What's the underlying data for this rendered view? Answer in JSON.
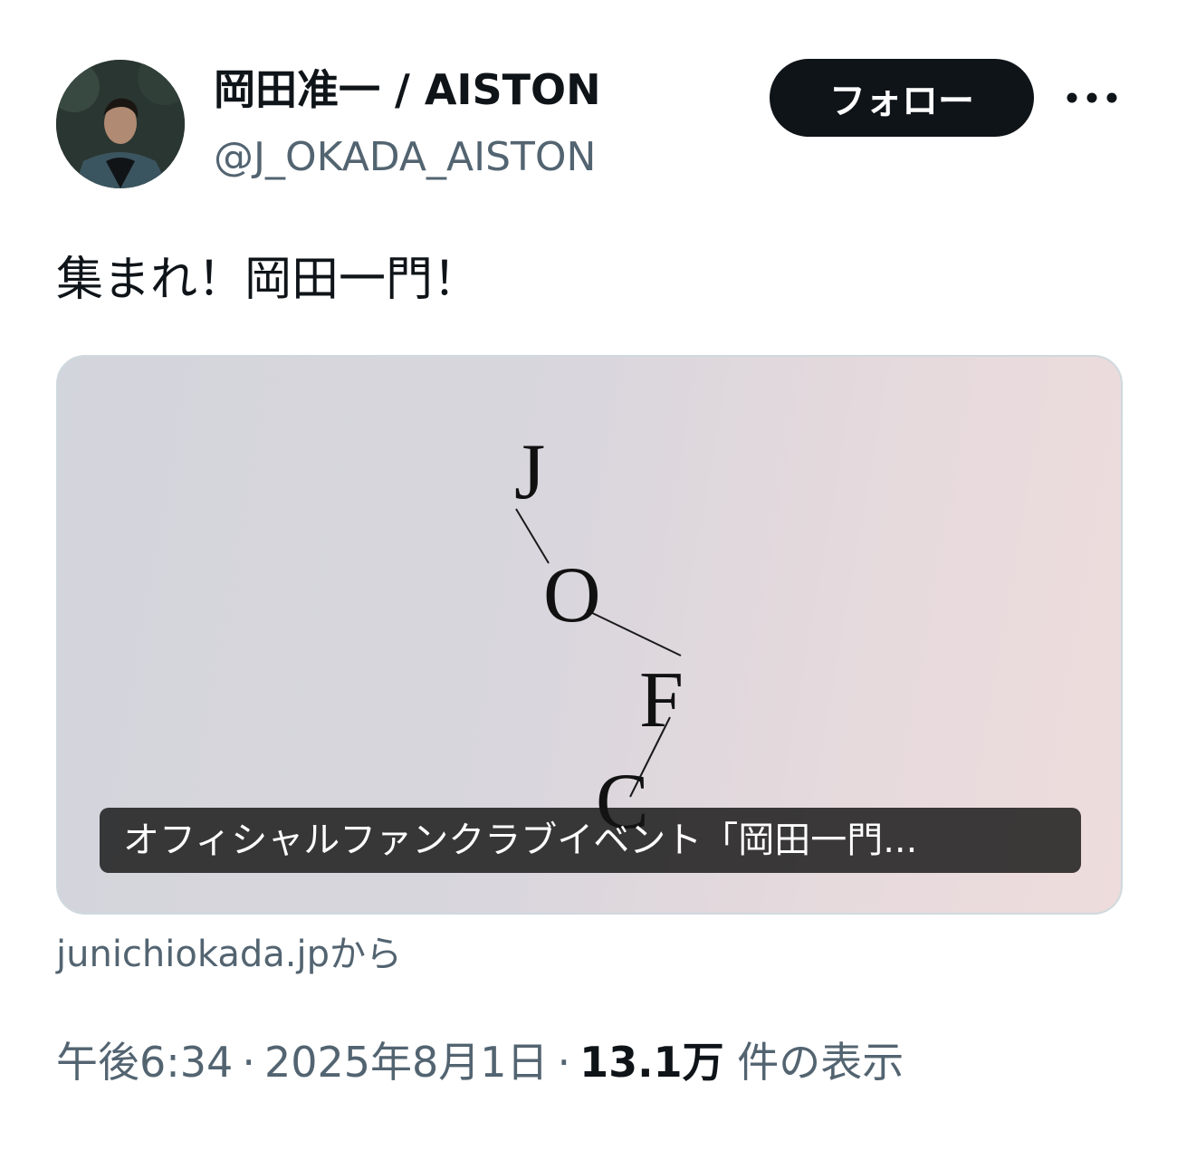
{
  "author": {
    "display_name": "岡田准一 / AISTON",
    "handle": "@J_OKADA_AISTON",
    "avatar_icon": "profile-photo"
  },
  "actions": {
    "follow_label": "フォロー",
    "more_icon": "more-horizontal-icon"
  },
  "tweet": {
    "text": "集まれ！岡田一門！"
  },
  "link_card": {
    "image_letters": [
      "J",
      "O",
      "F",
      "C"
    ],
    "title": "オフィシャルファンクラブイベント「岡田一門...",
    "source": "junichiokada.jpから"
  },
  "meta": {
    "time": "午後6:34",
    "separator": "·",
    "date": "2025年8月1日",
    "views_count": "13.1万",
    "views_label": "件の表示"
  },
  "colors": {
    "text_primary": "#0f1419",
    "text_secondary": "#536471",
    "follow_bg": "#0f1419",
    "card_border": "#cfd9de"
  }
}
